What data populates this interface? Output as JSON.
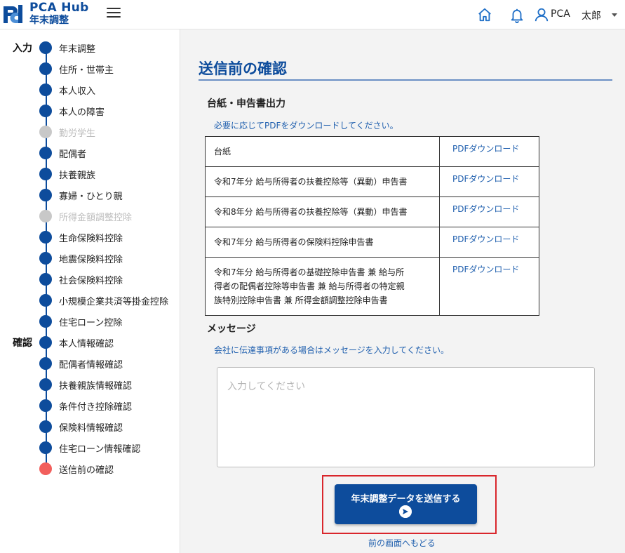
{
  "header": {
    "brand_name": "PCA Hub",
    "brand_sub": "年末調整",
    "user_name": "PCA",
    "user_person": "太郎"
  },
  "sidebar": {
    "input_label": "入力",
    "confirm_label": "確認",
    "input_steps": [
      {
        "label": "年末調整",
        "state": "done"
      },
      {
        "label": "住所・世帯主",
        "state": "done"
      },
      {
        "label": "本人収入",
        "state": "done"
      },
      {
        "label": "本人の障害",
        "state": "done"
      },
      {
        "label": "勤労学生",
        "state": "disabled"
      },
      {
        "label": "配偶者",
        "state": "done"
      },
      {
        "label": "扶養親族",
        "state": "done"
      },
      {
        "label": "寡婦・ひとり親",
        "state": "done"
      },
      {
        "label": "所得金額調整控除",
        "state": "disabled"
      },
      {
        "label": "生命保険料控除",
        "state": "done"
      },
      {
        "label": "地震保険料控除",
        "state": "done"
      },
      {
        "label": "社会保険料控除",
        "state": "done"
      },
      {
        "label": "小規模企業共済等掛金控除",
        "state": "done"
      },
      {
        "label": "住宅ローン控除",
        "state": "done"
      }
    ],
    "confirm_steps": [
      {
        "label": "本人情報確認",
        "state": "done"
      },
      {
        "label": "配偶者情報確認",
        "state": "done"
      },
      {
        "label": "扶養親族情報確認",
        "state": "done"
      },
      {
        "label": "条件付き控除確認",
        "state": "done"
      },
      {
        "label": "保険料情報確認",
        "state": "done"
      },
      {
        "label": "住宅ローン情報確認",
        "state": "done"
      },
      {
        "label": "送信前の確認",
        "state": "current"
      }
    ]
  },
  "main": {
    "title": "送信前の確認",
    "docs_section": {
      "title": "台紙・申告書出力",
      "note": "必要に応じてPDFをダウンロードしてください。",
      "rows": [
        {
          "name_lines": [
            "台紙"
          ],
          "link": "PDFダウンロード"
        },
        {
          "name_lines": [
            "令和7年分 給与所得者の扶養控除等（異動）申告書"
          ],
          "link": "PDFダウンロード"
        },
        {
          "name_lines": [
            "令和8年分 給与所得者の扶養控除等（異動）申告書"
          ],
          "link": "PDFダウンロード"
        },
        {
          "name_lines": [
            "令和7年分 給与所得者の保険料控除申告書"
          ],
          "link": "PDFダウンロード"
        },
        {
          "name_lines": [
            "令和7年分 給与所得者の基礎控除申告書 兼 給与所",
            "得者の配偶者控除等申告書 兼 給与所得者の特定親",
            "族特別控除申告書 兼 所得金額調整控除申告書"
          ],
          "link": "PDFダウンロード"
        }
      ]
    },
    "message_section": {
      "title": "メッセージ",
      "note": "会社に伝達事項がある場合はメッセージを入力してください。",
      "placeholder": "入力してください",
      "value": ""
    },
    "submit_label": "年末調整データを送信する",
    "back_label": "前の画面へもどる"
  },
  "colors": {
    "brand": "#0d4c9c",
    "link": "#1f5fae",
    "current_step": "#f25f5c",
    "disabled_step": "#c8c8c8",
    "highlight": "#d9262c"
  },
  "icons": {
    "logo": "pca-logo-icon",
    "menu": "hamburger-menu-icon",
    "home": "home-icon",
    "notifications": "bell-icon",
    "user": "user-icon",
    "dropdown": "caret-down-icon",
    "send": "send-arrow-icon"
  }
}
